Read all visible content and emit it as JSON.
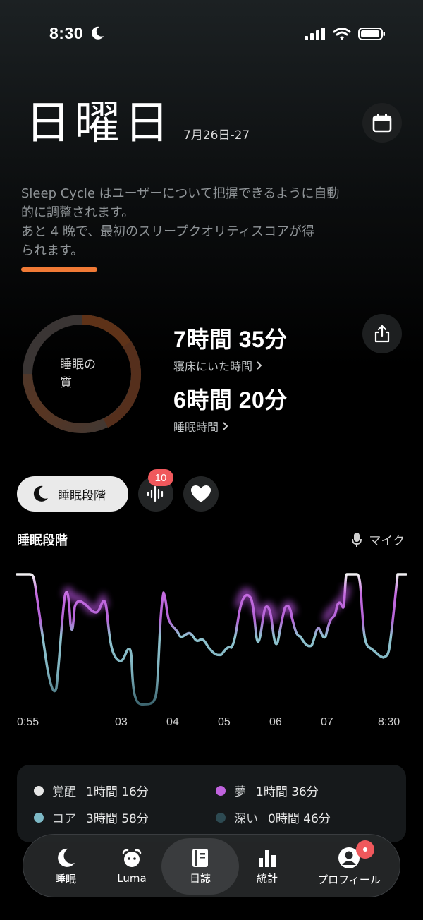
{
  "status": {
    "time": "8:30"
  },
  "header": {
    "title": "日曜日",
    "date_range": "7月26日-27"
  },
  "info": {
    "line1": "Sleep Cycle はユーザーについて把握できるように自動",
    "line2": "的に調整されます。",
    "line3": "あと 4 晩で、最初のスリープクオリティスコアが得",
    "line4": "られます。",
    "progress": 0.2
  },
  "quality": {
    "label_line1": "睡眠の",
    "label_line2": "質"
  },
  "stats": {
    "in_bed_value": "7時間 35分",
    "in_bed_label": "寝床にいた時間",
    "asleep_value": "6時間 20分",
    "asleep_label": "睡眠時間"
  },
  "chips": {
    "sleep_stages": "睡眠段階",
    "sounds_count": "10"
  },
  "section": {
    "title": "睡眠段階",
    "mic": "マイク"
  },
  "axis": {
    "start": "0:55",
    "t1": "03",
    "t2": "04",
    "t3": "05",
    "t4": "06",
    "t5": "07",
    "end": "8:30"
  },
  "legend": {
    "awake": {
      "label": "覚醒",
      "value": "1時間 16分",
      "color": "#e6e6e6"
    },
    "rem": {
      "label": "夢",
      "value": "1時間 36分",
      "color": "#c063de"
    },
    "core": {
      "label": "コア",
      "value": "3時間 58分",
      "color": "#7db9c6"
    },
    "deep": {
      "label": "深い",
      "value": "0時間 46分",
      "color": "#2d4a52"
    }
  },
  "tabs": {
    "sleep": "睡眠",
    "luma": "Luma",
    "journal": "日誌",
    "stats": "統計",
    "profile": "プロフィール"
  }
}
